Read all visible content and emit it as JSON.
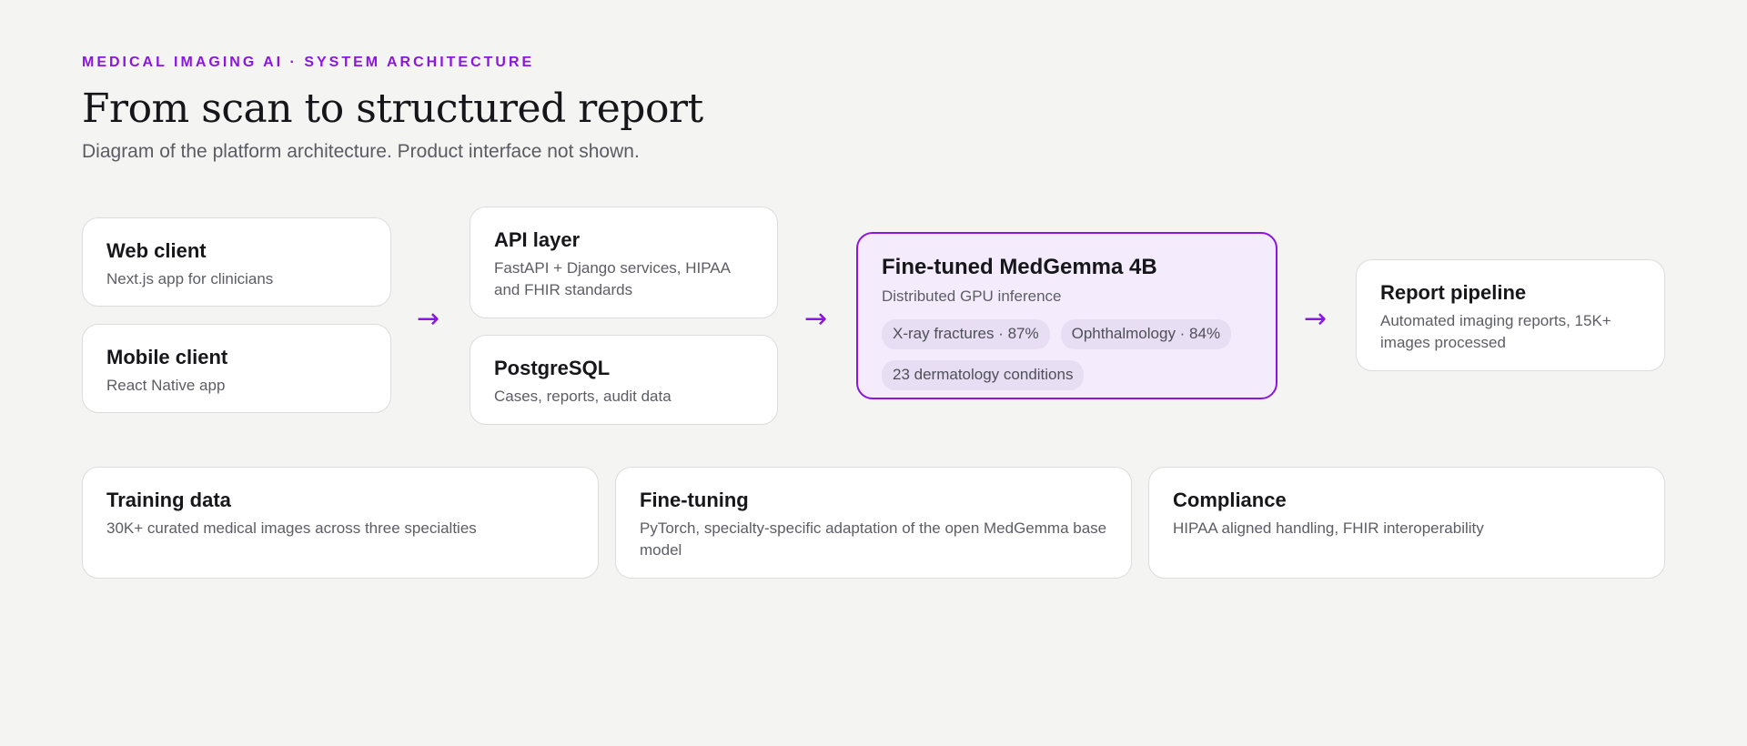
{
  "header": {
    "eyebrow": "MEDICAL IMAGING AI · SYSTEM ARCHITECTURE",
    "title": "From scan to structured report",
    "subtitle": "Diagram of the platform architecture. Product interface not shown."
  },
  "clients": [
    {
      "title": "Web client",
      "desc": "Next.js app for clinicians"
    },
    {
      "title": "Mobile client",
      "desc": "React Native app"
    }
  ],
  "backend": [
    {
      "title": "API layer",
      "desc": "FastAPI + Django services, HIPAA and FHIR standards"
    },
    {
      "title": "PostgreSQL",
      "desc": "Cases, reports, audit data"
    }
  ],
  "model": {
    "title": "Fine-tuned MedGemma 4B",
    "desc": "Distributed GPU inference",
    "chips": [
      "X-ray fractures · 87%",
      "Ophthalmology · 84%",
      "23 dermatology conditions"
    ]
  },
  "report": {
    "title": "Report pipeline",
    "desc": "Automated imaging reports, 15K+ images processed"
  },
  "foundation": [
    {
      "title": "Training data",
      "desc": "30K+ curated medical images across three specialties"
    },
    {
      "title": "Fine-tuning",
      "desc": "PyTorch, specialty-specific adaptation of the open MedGemma base model"
    },
    {
      "title": "Compliance",
      "desc": "HIPAA aligned handling, FHIR interoperability"
    }
  ],
  "arrows": {
    "glyph": "→"
  },
  "colors": {
    "accent": "#8a16e0",
    "highlight_bg": "#f4ecfd",
    "chip_bg": "#e8def4",
    "background": "#f4f4f2"
  }
}
